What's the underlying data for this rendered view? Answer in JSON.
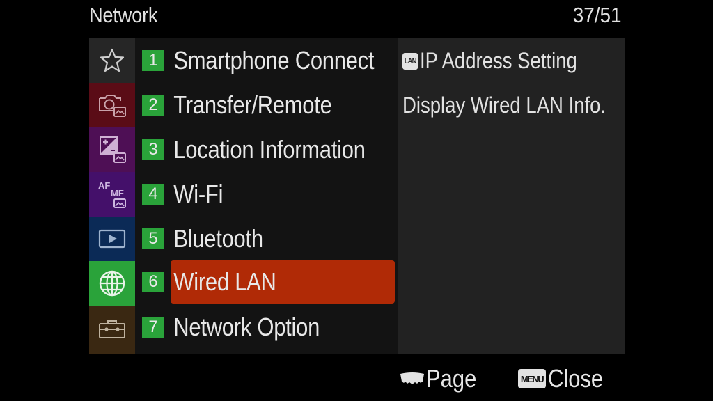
{
  "header": {
    "title": "Network",
    "page_indicator": "37/51"
  },
  "sidebar": {
    "tabs": [
      {
        "icon": "star-icon",
        "color": "#262626",
        "selected": false
      },
      {
        "icon": "camera-photo-icon",
        "color": "#5a0c16",
        "selected": false
      },
      {
        "icon": "exposure-photo-icon",
        "color": "#4e0f55",
        "selected": false
      },
      {
        "icon": "af-mf-icon",
        "color": "#44106a",
        "selected": false
      },
      {
        "icon": "playback-icon",
        "color": "#0b2a56",
        "selected": false
      },
      {
        "icon": "globe-network-icon",
        "color": "#2aa33a",
        "selected": true
      },
      {
        "icon": "toolbox-icon",
        "color": "#3a2812",
        "selected": false
      }
    ]
  },
  "menu": {
    "items": [
      {
        "number": "1",
        "label": "Smartphone Connect",
        "selected": false
      },
      {
        "number": "2",
        "label": "Transfer/Remote",
        "selected": false
      },
      {
        "number": "3",
        "label": "Location Information",
        "selected": false
      },
      {
        "number": "4",
        "label": "Wi-Fi",
        "selected": false
      },
      {
        "number": "5",
        "label": "Bluetooth",
        "selected": false
      },
      {
        "number": "6",
        "label": "Wired LAN",
        "selected": true
      },
      {
        "number": "7",
        "label": "Network Option",
        "selected": false
      }
    ]
  },
  "detail": {
    "items": [
      {
        "badge": "LAN",
        "label": "IP Address Setting"
      },
      {
        "label": "Display Wired LAN Info."
      }
    ]
  },
  "footer": {
    "page_label": "Page",
    "menu_badge": "MENU",
    "close_label": "Close"
  },
  "colors": {
    "accent_selected": "#b02a06",
    "number_badge": "#2aa33a"
  }
}
